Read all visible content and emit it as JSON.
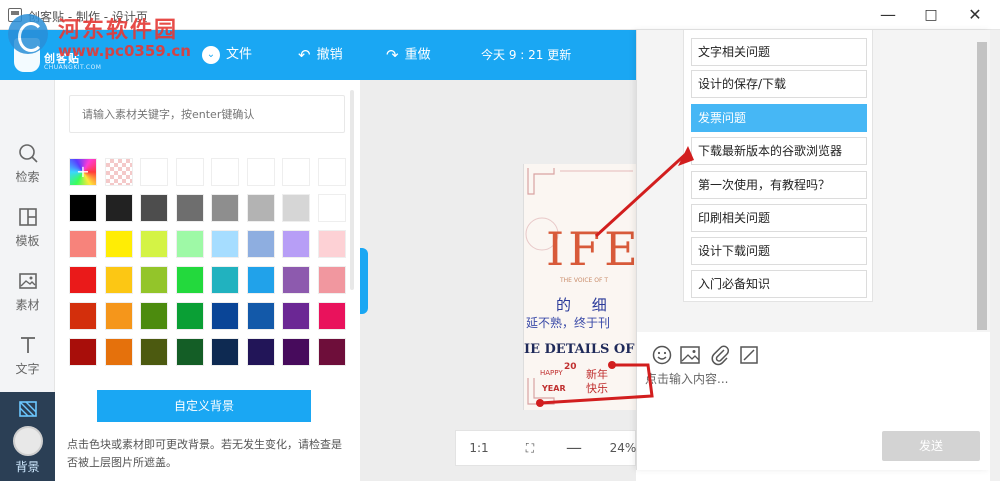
{
  "window": {
    "title": "创客贴 - 制作 - 设计页",
    "minimize_icon": "minimize-icon",
    "maximize_icon": "maximize-icon",
    "close_icon": "close-icon"
  },
  "watermark": {
    "name": "河东软件园",
    "url": "www.pc0359.cn"
  },
  "logo": {
    "text": "创客贴",
    "sub": "CHUANGKIT.COM"
  },
  "toolbar": {
    "file": "文件",
    "undo": "撤销",
    "redo": "重做",
    "status": "今天 9 : 21 更新"
  },
  "nav": [
    {
      "label": "检索",
      "icon": "search-icon"
    },
    {
      "label": "模板",
      "icon": "template-icon"
    },
    {
      "label": "素材",
      "icon": "image-icon"
    },
    {
      "label": "文字",
      "icon": "text-icon"
    },
    {
      "label": "背景",
      "icon": "background-icon"
    },
    {
      "label": "",
      "icon": "service-avatar-icon"
    }
  ],
  "panel": {
    "search_placeholder": "请输入素材关键字，按enter键确认",
    "custom_bg_button": "自定义背景",
    "hint": "点击色块或素材即可更改背景。若无发生变化，请检查是否被上层图片所遮盖。",
    "colors": [
      [
        "rainbow",
        "transparent",
        "#ffffff",
        "#ffffff",
        "#ffffff",
        "#ffffff",
        "#ffffff",
        "#ffffff"
      ],
      [
        "#000000",
        "#222222",
        "#4d4d4d",
        "#6e6e6e",
        "#8e8e8e",
        "#b3b3b3",
        "#d6d6d6",
        "#ffffff"
      ],
      [
        "#f7837b",
        "#ffed05",
        "#d4f345",
        "#9ef9a6",
        "#a6ddff",
        "#8eaee0",
        "#b79ef6",
        "#fdd1d5"
      ],
      [
        "#ea1a1a",
        "#fcc714",
        "#93c52a",
        "#23d93d",
        "#21b2bf",
        "#21a2ea",
        "#8d5aae",
        "#f1979f"
      ],
      [
        "#d32f0c",
        "#f5961b",
        "#4c8b0e",
        "#0a9f35",
        "#0a4597",
        "#1359a9",
        "#6b2794",
        "#e9125c"
      ],
      [
        "#a80e0a",
        "#e5710c",
        "#4c5a10",
        "#145e26",
        "#0e2a52",
        "#221558",
        "#470b5c",
        "#6e0e3a"
      ]
    ]
  },
  "canvas": {
    "design_text_big": "IFE",
    "design_text_small": "THE VOICE OF T",
    "design_cn1": "的 细",
    "design_cn2": "延不熟，终于刊",
    "design_en": "IE DETAILS OF L",
    "design_year": "20",
    "design_happy": "HAPPY",
    "design_year_label": "YEAR",
    "design_newyear": "新年",
    "design_joy": "快乐",
    "zoom_ratio": "1:1",
    "zoom_level": "24%",
    "fullscreen_icon": "fullscreen-icon",
    "zoom_out_icon": "minus-icon"
  },
  "chat": {
    "faq": [
      "文字相关问题",
      "设计的保存/下载",
      "发票问题",
      "下载最新版本的谷歌浏览器",
      "第一次使用，有教程吗？",
      "印刷相关问题",
      "设计下载问题",
      "入门必备知识"
    ],
    "selected": "发票问题",
    "input_placeholder": "点击输入内容...",
    "send": "发送",
    "tool_icons": [
      "emoji-icon",
      "image-icon",
      "attachment-icon",
      "screenshot-icon"
    ]
  }
}
